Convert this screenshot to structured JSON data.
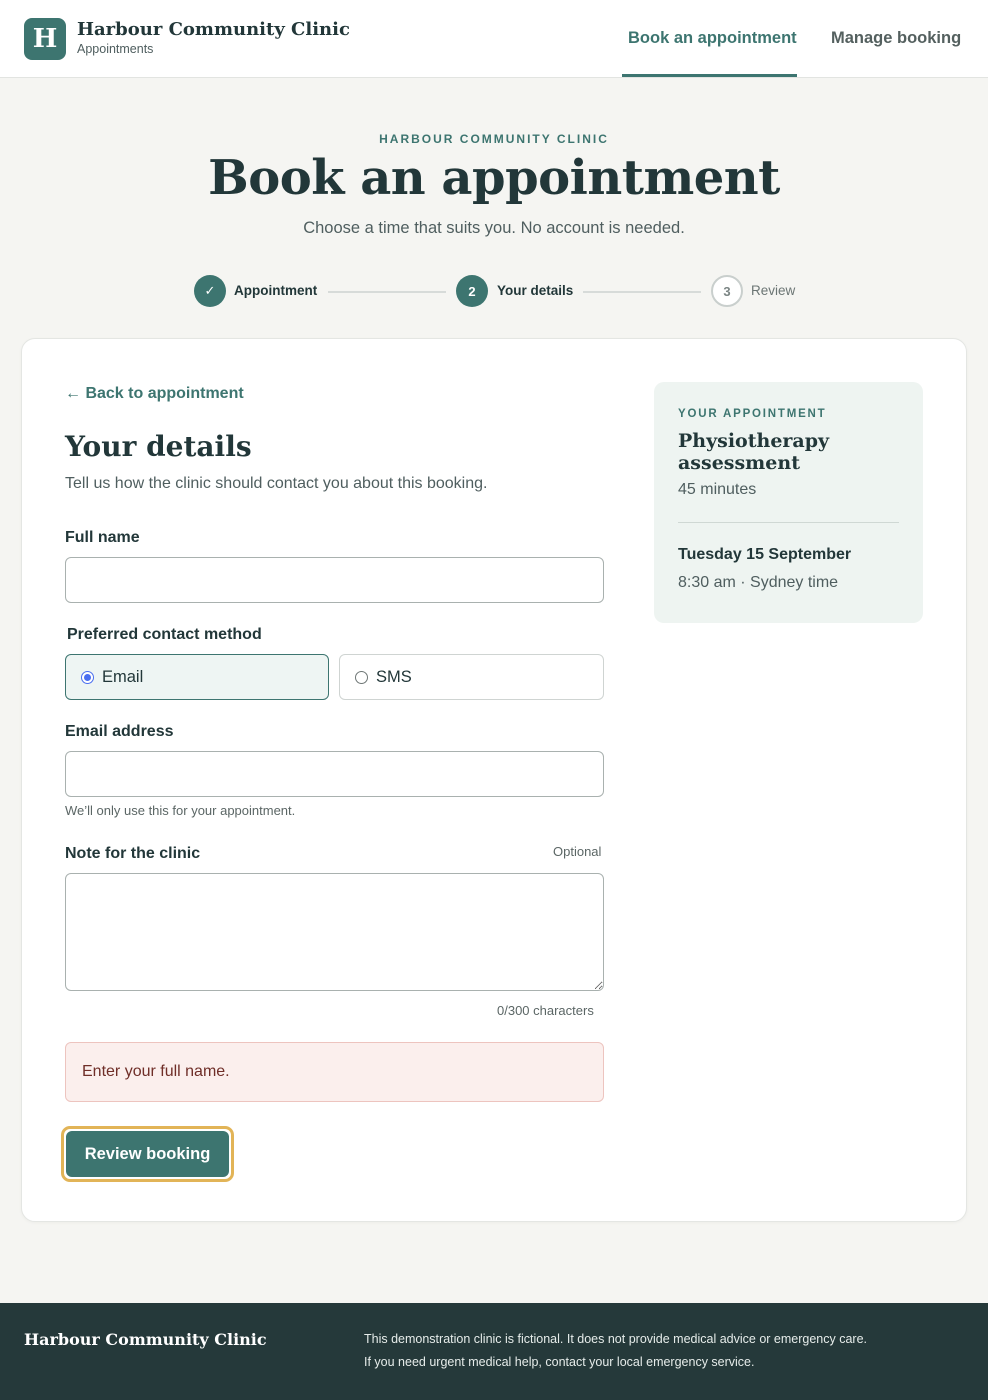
{
  "header": {
    "logo_letter": "H",
    "brand_name": "Harbour Community Clinic",
    "brand_sub": "Appointments",
    "nav": {
      "book": "Book an appointment",
      "manage": "Manage booking"
    }
  },
  "hero": {
    "eyebrow": "HARBOUR COMMUNITY CLINIC",
    "title": "Book an appointment",
    "subtitle": "Choose a time that suits you. No account is needed."
  },
  "stepper": {
    "step1": {
      "marker": "✓",
      "label": "Appointment",
      "state": "complete"
    },
    "step2": {
      "marker": "2",
      "label": "Your details",
      "state": "current"
    },
    "step3": {
      "marker": "3",
      "label": "Review",
      "state": "upcoming"
    }
  },
  "form": {
    "back_link": "← Back to appointment",
    "title": "Your details",
    "subtitle": "Tell us how the clinic should contact you about this booking.",
    "full_name": {
      "label": "Full name",
      "value": ""
    },
    "contact_method": {
      "label": "Preferred contact method",
      "options": [
        "Email",
        "SMS"
      ],
      "selected": "Email"
    },
    "email": {
      "label": "Email address",
      "value": "",
      "hint": "We’ll only use this for your appointment."
    },
    "note": {
      "label": "Note for the clinic",
      "optional": "Optional",
      "value": "",
      "counter": "0/300 characters"
    },
    "error": "Enter your full name.",
    "submit": "Review booking"
  },
  "summary": {
    "eyebrow": "YOUR APPOINTMENT",
    "service": "Physiotherapy assessment",
    "duration": "45 minutes",
    "date": "Tuesday 15 September",
    "time": "8:30 am · Sydney time"
  },
  "footer": {
    "brand": "Harbour Community Clinic",
    "line1": "This demonstration clinic is fictional. It does not provide medical advice or emergency care.",
    "line2": "If you need urgent medical help, contact your local emergency service."
  },
  "colors": {
    "accent": "#3d7570",
    "dark": "#223739",
    "focus_ring": "#e2b457",
    "error_bg": "#fbefed",
    "footer_bg": "#25393a"
  }
}
